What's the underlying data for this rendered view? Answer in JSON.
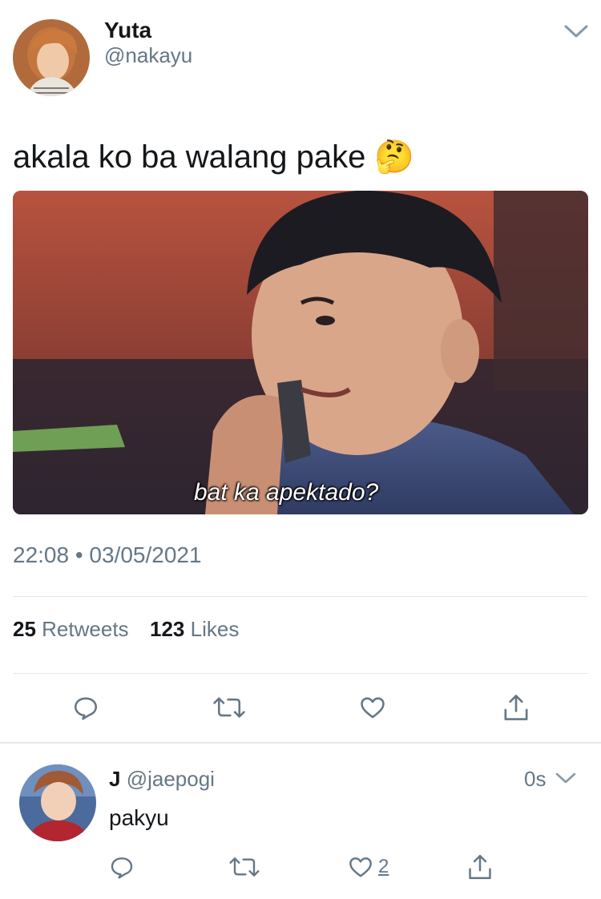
{
  "tweet": {
    "author": {
      "name": "Yuta",
      "handle": "@nakayu"
    },
    "text": "akala ko ba walang pake 🤔",
    "media": {
      "caption": "bat ka apektado?"
    },
    "timestamp": "22:08 • 03/05/2021",
    "stats": {
      "retweets_count": "25",
      "retweets_label": "Retweets",
      "likes_count": "123",
      "likes_label": "Likes"
    },
    "actions": [
      "reply-icon",
      "retweet-icon",
      "like-icon",
      "share-icon"
    ]
  },
  "reply": {
    "author": {
      "name": "J",
      "handle": "@jaepogi"
    },
    "time": "0s",
    "text": "pakyu",
    "like_count": "2"
  },
  "colors": {
    "text": "#14171a",
    "muted": "#657786",
    "divider": "#e1e8ed",
    "icon": "#657786"
  }
}
